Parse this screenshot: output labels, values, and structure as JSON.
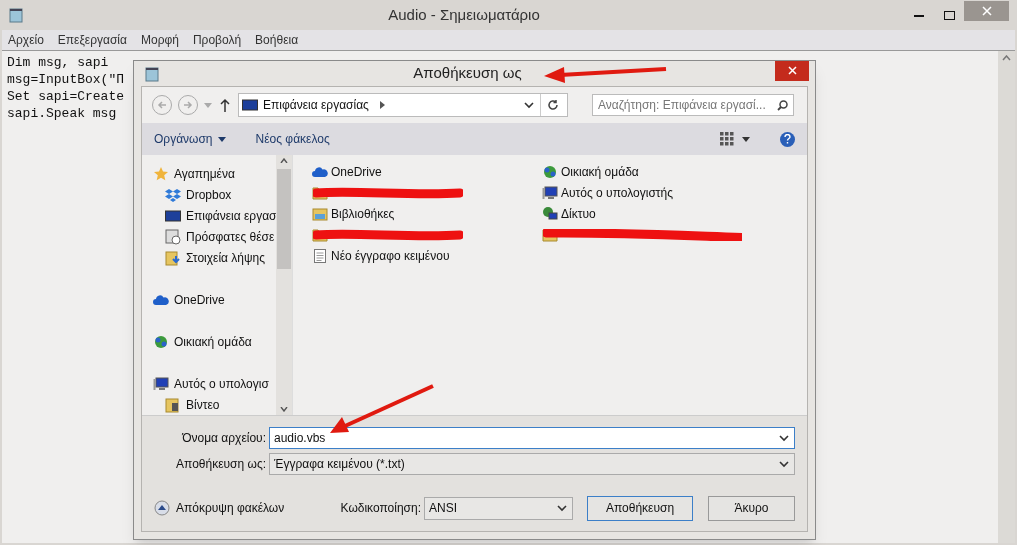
{
  "notepad": {
    "title": "Audio - Σημειωματάριο",
    "menu": [
      "Αρχείο",
      "Επεξεργασία",
      "Μορφή",
      "Προβολή",
      "Βοήθεια"
    ],
    "lines": [
      "Dim msg, sapi",
      "msg=InputBox(\"Π",
      "Set sapi=Create",
      "sapi.Speak msg"
    ]
  },
  "dialog": {
    "title": "Αποθήκευση ως",
    "address": "Επιφάνεια εργασίας",
    "search_placeholder": "Αναζήτηση: Επιφάνεια εργασί...",
    "toolbar": {
      "organize": "Οργάνωση",
      "new_folder": "Νέος φάκελος"
    },
    "nav_groups": [
      {
        "label": "Αγαπημένα",
        "kind": "star",
        "children": [
          {
            "label": "Dropbox",
            "kind": "dropbox"
          },
          {
            "label": "Επιφάνεια εργασ",
            "kind": "desktop"
          },
          {
            "label": "Πρόσφατες θέσε",
            "kind": "recent"
          },
          {
            "label": "Στοιχεία λήψης",
            "kind": "downloads"
          }
        ]
      },
      {
        "label": "OneDrive",
        "kind": "cloud"
      },
      {
        "label": "Οικιακή ομάδα",
        "kind": "homegroup"
      },
      {
        "label": "Αυτός ο υπολογισ",
        "kind": "computer",
        "children": [
          {
            "label": "Βίντεο",
            "kind": "video"
          }
        ]
      }
    ],
    "columns": [
      [
        {
          "label": "OneDrive",
          "kind": "cloud"
        },
        {
          "kind": "redacted"
        },
        {
          "label": "Βιβλιοθήκες",
          "kind": "library"
        },
        {
          "kind": "redacted"
        },
        {
          "label": "Νέο έγγραφο κειμένου",
          "kind": "textfile"
        }
      ],
      [
        {
          "label": "Οικιακή ομάδα",
          "kind": "homegroup"
        },
        {
          "label": "Αυτός ο υπολογιστής",
          "kind": "computer"
        },
        {
          "label": "Δίκτυο",
          "kind": "network"
        },
        {
          "kind": "redacted"
        }
      ]
    ],
    "filename": {
      "label": "Όνομα αρχείου:",
      "value": "audio.vbs"
    },
    "save_type": {
      "label": "Αποθήκευση ως:",
      "value": "Έγγραφα κειμένου (*.txt)"
    },
    "hide_folders": "Απόκρυψη φακέλων",
    "encoding": {
      "label": "Κωδικοποίηση:",
      "value": "ANSI"
    },
    "buttons": [
      {
        "label": "Αποθήκευση",
        "default": true
      },
      {
        "label": "Άκυρο",
        "default": false
      }
    ]
  }
}
